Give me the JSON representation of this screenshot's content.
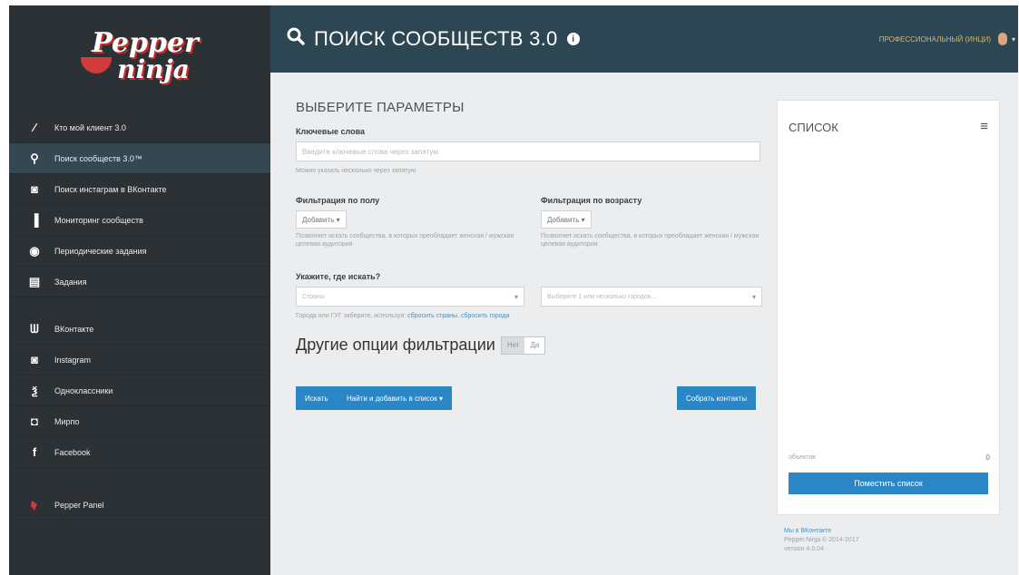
{
  "app": {
    "logo_line1": "Pepper",
    "logo_line2": "ninja"
  },
  "sidebar": {
    "items": [
      {
        "icon": "wand-icon",
        "glyph": "⁄",
        "label": "Кто мой клиент 3.0"
      },
      {
        "icon": "search-icon",
        "glyph": "⚲",
        "label": "Поиск сообществ 3.0™",
        "active": true
      },
      {
        "icon": "instagram-icon",
        "glyph": "◙",
        "label": "Поиск инстаграм в ВКонтакте"
      },
      {
        "icon": "chart-icon",
        "glyph": "▐",
        "label": "Мониторинг сообществ"
      },
      {
        "icon": "clock-icon",
        "glyph": "◉",
        "label": "Периодические задания"
      },
      {
        "icon": "tasks-icon",
        "glyph": "▤",
        "label": "Задания"
      }
    ],
    "networks": [
      {
        "icon": "vk-icon",
        "glyph": "ᗯ",
        "label": "ВКонтакте"
      },
      {
        "icon": "instagram-icon",
        "glyph": "◙",
        "label": "Instagram"
      },
      {
        "icon": "odnoklassniki-icon",
        "glyph": "ѯ",
        "label": "Одноклассники"
      },
      {
        "icon": "mail-icon",
        "glyph": "◘",
        "label": "Мирпо"
      },
      {
        "icon": "facebook-icon",
        "glyph": "f",
        "label": "Facebook"
      }
    ],
    "bottom": {
      "icon": "pepper-icon",
      "label": "Pepper Panel"
    }
  },
  "header": {
    "title": "ПОИСК СООБЩЕСТВ 3.0",
    "info_glyph": "i",
    "user_label": "ПРОФЕССИОНАЛЬНЫЙ (ИНЦИ)",
    "caret": "▾"
  },
  "form": {
    "heading": "ВЫБЕРИТЕ ПАРАМЕТРЫ",
    "keywords_label": "Ключевые слова",
    "keywords_placeholder": "Введите ключевые слова через запятую",
    "keywords_help": "Можно указать несколько через запятую",
    "gender_label": "Фильтрация по полу",
    "gender_button": "Добавить ▾",
    "gender_help": "Позволяет искать сообщества, в которых преобладает женская / мужская целевая аудитория",
    "age_label": "Фильтрация по возрасту",
    "age_button": "Добавить ▾",
    "age_help": "Позволяет искать сообщества, в которых преобладает женская / мужская целевая аудитория",
    "where_label": "Укажите, где искать?",
    "where_select1": "Страны",
    "where_select2": "Выберите 1 или несколько городов...",
    "where_help_prefix": "Города или ГУГ заберите, используя:",
    "where_link1": "сбросить страны",
    "where_link2": "сбросить города",
    "more_options": "Другие опции фильтрации",
    "toggle_no": "Нет",
    "toggle_yes": "Да",
    "btn_search": "Искать",
    "btn_find_add": "Найти и добавить в список ▾",
    "btn_collect": "Собрать контакты"
  },
  "list_panel": {
    "title": "СПИСОК",
    "menu_glyph": "≡",
    "objects_label": "объектов",
    "objects_count": "0",
    "save_button": "Поместить список"
  },
  "footer": {
    "line1": "Мы в ВКонтакте",
    "line2": "Pepper.Ninja © 2014-2017",
    "line3": "version 4.0.04"
  }
}
